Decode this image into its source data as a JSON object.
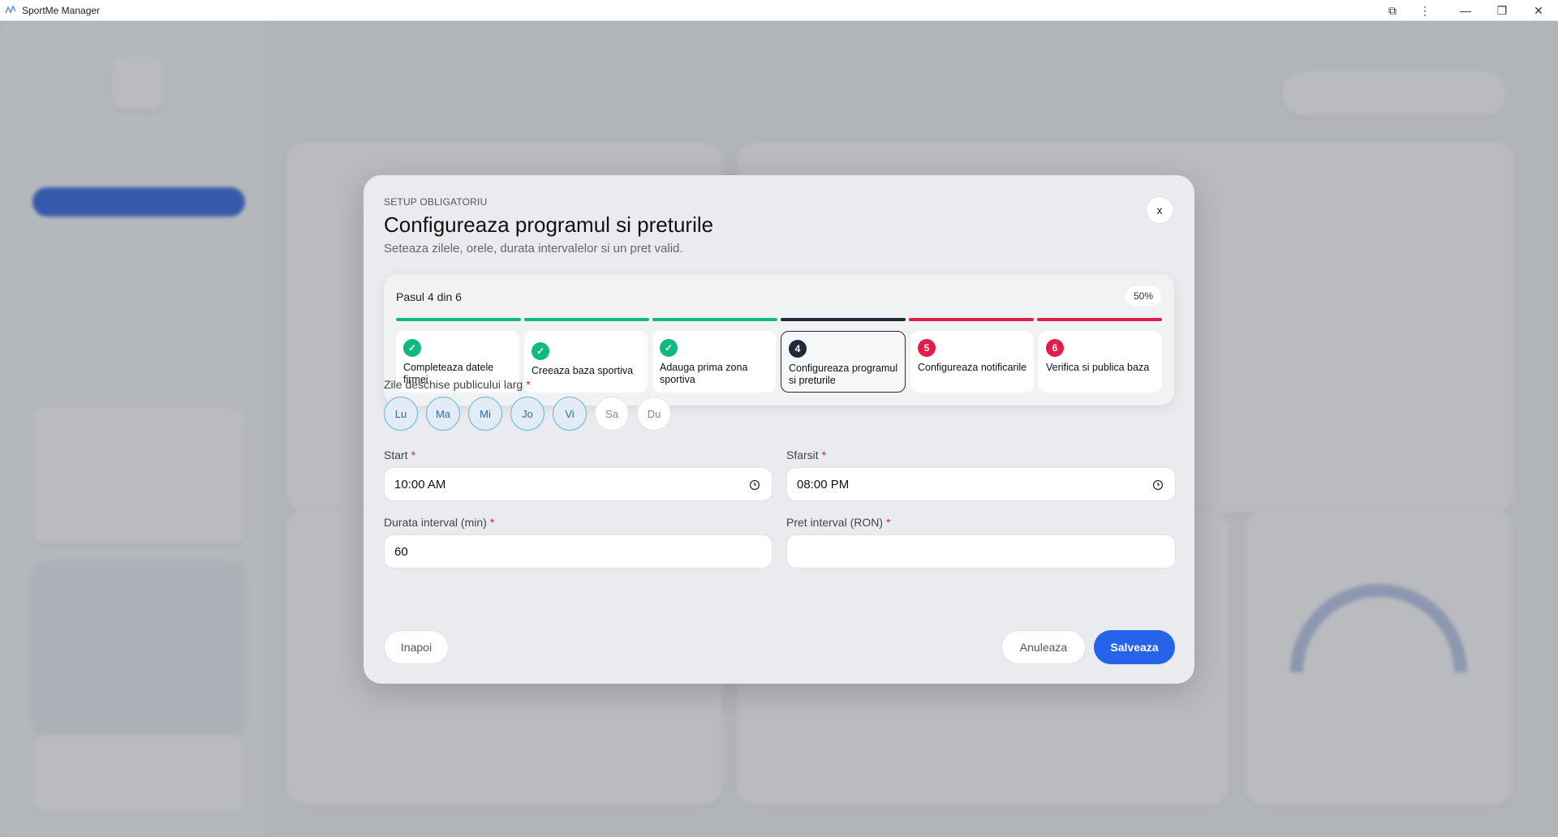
{
  "window": {
    "title": "SportMe Manager",
    "controls": {
      "extensions": "⧉",
      "menu": "⋮",
      "minimize": "—",
      "restore": "❐",
      "close": "✕"
    }
  },
  "modal": {
    "eyebrow": "SETUP OBLIGATORIU",
    "title": "Configureaza programul si preturile",
    "subtitle": "Seteaza zilele, orele, durata intervalelor si un pret valid.",
    "close_label": "x",
    "progress": {
      "label": "Pasul 4 din 6",
      "percent_label": "50%",
      "percent": 50,
      "current_step": 4,
      "steps": [
        {
          "badge": "✓",
          "label": "Completeaza datele firmei",
          "status": "done"
        },
        {
          "badge": "✓",
          "label": "Creeaza baza sportiva",
          "status": "done"
        },
        {
          "badge": "✓",
          "label": "Adauga prima zona sportiva",
          "status": "done"
        },
        {
          "badge": "4",
          "label": "Configureaza programul si preturile",
          "status": "current"
        },
        {
          "badge": "5",
          "label": "Configureaza notificarile",
          "status": "todo"
        },
        {
          "badge": "6",
          "label": "Verifica si publica baza",
          "status": "todo"
        }
      ]
    },
    "days_label": "Zile deschise publicului larg",
    "days": [
      {
        "label": "Lu",
        "selected": true
      },
      {
        "label": "Ma",
        "selected": true
      },
      {
        "label": "Mi",
        "selected": true
      },
      {
        "label": "Jo",
        "selected": true
      },
      {
        "label": "Vi",
        "selected": true
      },
      {
        "label": "Sa",
        "selected": false
      },
      {
        "label": "Du",
        "selected": false
      }
    ],
    "start_label": "Start",
    "start_value": "10:00  AM",
    "end_label": "Sfarsit",
    "end_value": "08:00  PM",
    "duration_label": "Durata interval (min)",
    "duration_value": "60",
    "price_label": "Pret interval (RON)",
    "price_value": "",
    "required_mark": "*",
    "buttons": {
      "back": "Inapoi",
      "cancel": "Anuleaza",
      "save": "Salveaza"
    }
  },
  "colors": {
    "done": "#10b981",
    "current": "#1f2937",
    "todo": "#e11d48",
    "primary": "#2563eb"
  }
}
